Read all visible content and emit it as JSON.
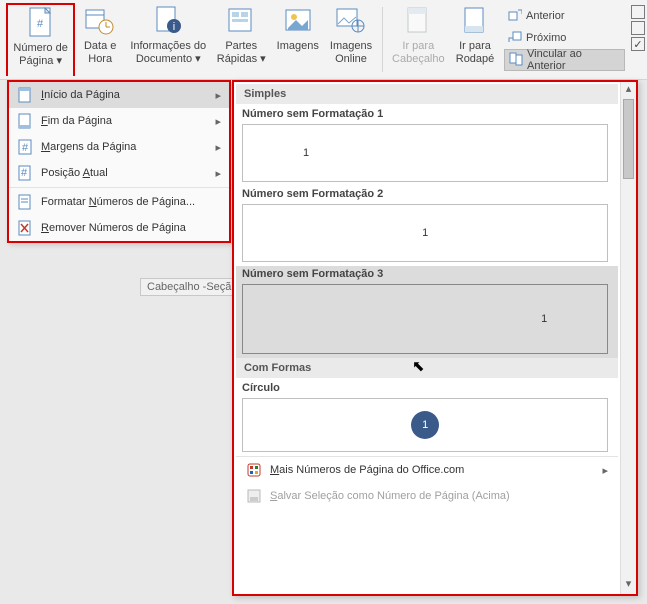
{
  "ribbon": {
    "page_number": "Número de\nPágina ▾",
    "date_time": "Data e\nHora",
    "doc_info": "Informações do\nDocumento ▾",
    "quick_parts": "Partes\nRápidas ▾",
    "images": "Imagens",
    "online_images": "Imagens\nOnline",
    "goto_header": "Ir para\nCabeçalho",
    "goto_footer": "Ir para\nRodapé",
    "previous": "Anterior",
    "next": "Próximo",
    "link_previous": "Vincular ao Anterior"
  },
  "menu": {
    "top_of_page": "Início da Página",
    "bottom_of_page": "Fim da Página",
    "page_margins": "Margens da Página",
    "current_position": "Posição Atual",
    "format_numbers": "Formatar Números de Página...",
    "remove_numbers": "Remover Números de Página"
  },
  "gallery": {
    "cat_simple": "Simples",
    "item1": "Número sem Formatação 1",
    "item2": "Número sem Formatação 2",
    "item3": "Número sem Formatação 3",
    "cat_shapes": "Com Formas",
    "item_circle": "Círculo",
    "preview_number": "1",
    "more_office": "Mais Números de Página do Office.com",
    "save_selection": "Salvar Seleção como Número de Página (Acima)"
  },
  "doc": {
    "header_section_tag": "Cabeçalho -Seçã"
  }
}
